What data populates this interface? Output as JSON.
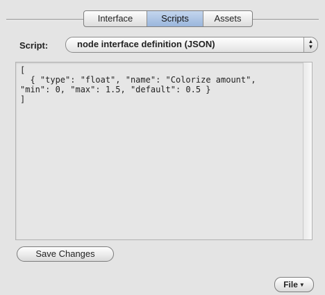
{
  "tabs": [
    {
      "label": "Interface",
      "active": false
    },
    {
      "label": "Scripts",
      "active": true
    },
    {
      "label": "Assets",
      "active": false
    }
  ],
  "script": {
    "label": "Script:",
    "selected": "node interface definition (JSON)"
  },
  "editor": {
    "content": "[\n  { \"type\": \"float\", \"name\": \"Colorize amount\",\n\"min\": 0, \"max\": 1.5, \"default\": 0.5 }\n]"
  },
  "buttons": {
    "save_label": "Save Changes",
    "file_label": "File"
  },
  "colors": {
    "active_tab": "#9ab6dc",
    "panel_bg": "#e4e4e4"
  }
}
